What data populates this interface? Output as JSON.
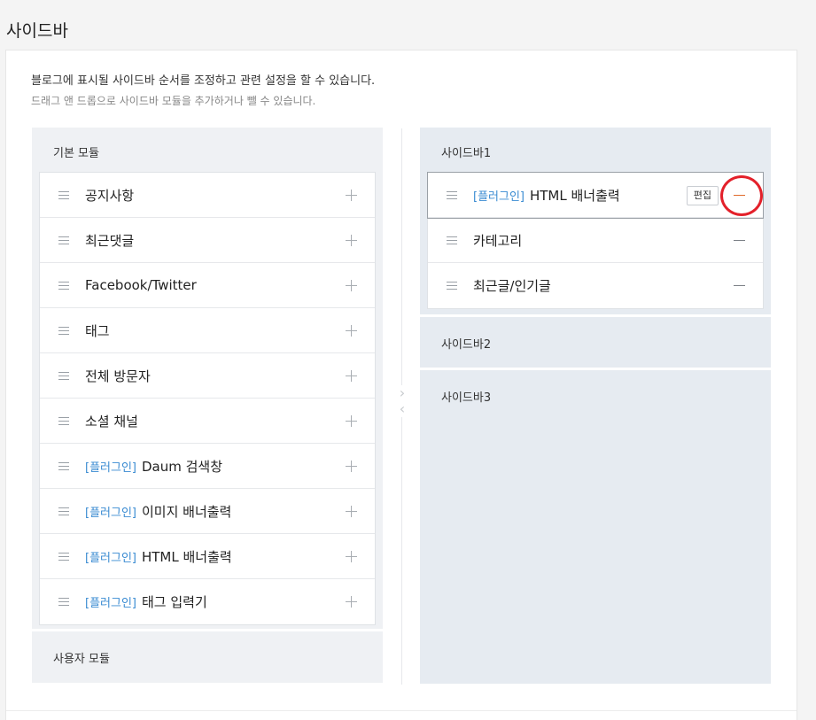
{
  "page": {
    "title": "사이드바"
  },
  "description": {
    "line1": "블로그에 표시될 사이드바 순서를 조정하고 관련 설정을 할 수 있습니다.",
    "line2": "드래그 앤 드롭으로 사이드바 모듈을 추가하거나 뺄 수 있습니다."
  },
  "basic_modules": {
    "title": "기본 모듈",
    "items": [
      {
        "tag": "",
        "label": "공지사항"
      },
      {
        "tag": "",
        "label": "최근댓글"
      },
      {
        "tag": "",
        "label": "Facebook/Twitter"
      },
      {
        "tag": "",
        "label": "태그"
      },
      {
        "tag": "",
        "label": "전체 방문자"
      },
      {
        "tag": "",
        "label": "소셜 채널"
      },
      {
        "tag": "[플러그인]",
        "label": "Daum 검색창"
      },
      {
        "tag": "[플러그인]",
        "label": "이미지 배너출력"
      },
      {
        "tag": "[플러그인]",
        "label": "HTML 배너출력"
      },
      {
        "tag": "[플러그인]",
        "label": "태그 입력기"
      }
    ]
  },
  "user_modules": {
    "title": "사용자 모듈"
  },
  "arrows": {
    "right": "›",
    "left": "‹"
  },
  "sidebar1": {
    "title": "사이드바1",
    "items": [
      {
        "tag": "[플러그인]",
        "label": "HTML 배너출력",
        "edit_label": "편집"
      },
      {
        "tag": "",
        "label": "카테고리"
      },
      {
        "tag": "",
        "label": "최근글/인기글"
      }
    ]
  },
  "sidebar2": {
    "title": "사이드바2"
  },
  "sidebar3": {
    "title": "사이드바3"
  },
  "colors": {
    "plugin_tag": "#3a8bd2",
    "highlight_circle": "#e3202a",
    "panel_basic": "#eff1f4",
    "panel_sidebar": "#e6ebf1"
  },
  "icons": {
    "handle": "drag-handle-icon",
    "add": "plus-icon",
    "remove": "minus-icon"
  }
}
